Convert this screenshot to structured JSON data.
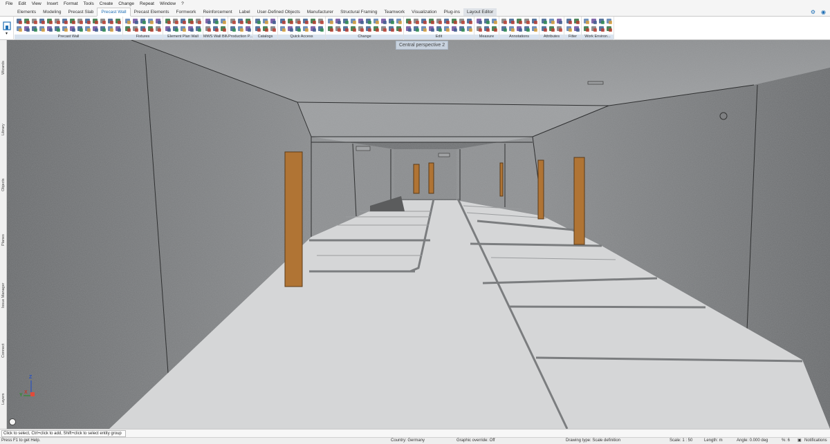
{
  "menu": [
    "File",
    "Edit",
    "View",
    "Insert",
    "Format",
    "Tools",
    "Create",
    "Change",
    "Repeat",
    "Window",
    "?"
  ],
  "tabs": [
    "Elements",
    "Modeling",
    "Precast Slab",
    "Precast Wall",
    "Precast Elements",
    "Formwork",
    "Reinforcement",
    "Label",
    "User-Defined Objects",
    "Manufacturer",
    "Structural Framing",
    "Teamwork",
    "Visualization",
    "Plug-ins",
    "Layout Editor"
  ],
  "active_tab": "Precast Wall",
  "ribbon_groups": [
    {
      "label": "Precast Wall",
      "cols": 14
    },
    {
      "label": "Fixtures",
      "cols": 5
    },
    {
      "label": "Element Plan Wall",
      "cols": 5
    },
    {
      "label": "MWS Wall BIM doss...",
      "cols": 3
    },
    {
      "label": "Production P...",
      "cols": 3
    },
    {
      "label": "Catalogs",
      "cols": 3
    },
    {
      "label": "Quick Access",
      "cols": 6
    },
    {
      "label": "Change",
      "cols": 10
    },
    {
      "label": "Edit",
      "cols": 9
    },
    {
      "label": "Measure",
      "cols": 3
    },
    {
      "label": "Annotations",
      "cols": 5
    },
    {
      "label": "Attributes",
      "cols": 3
    },
    {
      "label": "Filter",
      "cols": 2
    },
    {
      "label": "Work Environ...",
      "cols": 4
    }
  ],
  "left_dock": [
    "Wizards",
    "Library",
    "Objects",
    "Planes",
    "Issue Manager",
    "Connect",
    "Layers"
  ],
  "viewport": {
    "title": "Central perspective 2",
    "axis_x": "X",
    "axis_y": "Y",
    "axis_z": "Z"
  },
  "prompt": "Click to select, Ctrl+click to add, Shift+click to select entity group",
  "status": {
    "help": "Press F1 to get Help.",
    "country": "Country:   Germany",
    "graphic_override": "Graphic override:   Off",
    "drawing_type": "Drawing type:   Scale definition",
    "scale": "Scale:   1 : 50",
    "length": "Length:   m",
    "angle": "Angle:   0.000    deg",
    "percent": "%:   6",
    "notifications": "Notifications"
  },
  "colors": {
    "accent": "#1f6fb5",
    "door": "#b07434",
    "floor": "#d5d6d7",
    "wall": "#6f7173"
  }
}
